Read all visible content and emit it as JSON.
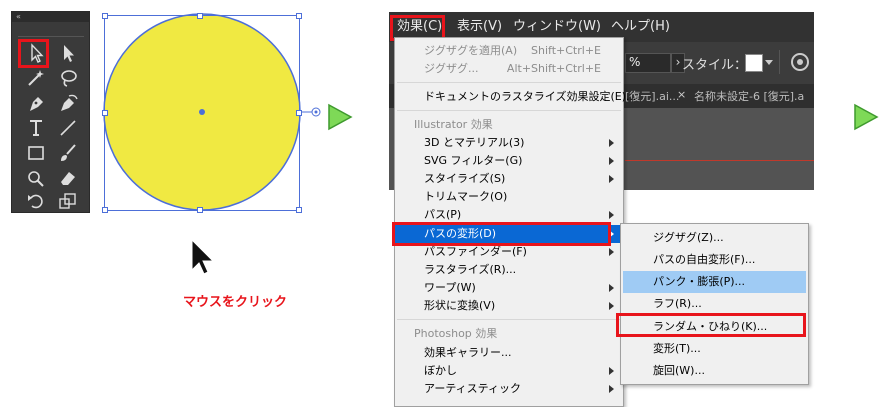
{
  "tools_panel": {
    "collapse_glyph": "«",
    "tool_names": [
      "selection-tool",
      "direct-selection-tool",
      "magic-wand-tool",
      "lasso-tool",
      "pen-tool",
      "curvature-tool",
      "type-tool",
      "line-segment-tool",
      "rectangle-tool",
      "paintbrush-tool",
      "shaper-tool",
      "eraser-tool",
      "rotate-tool",
      "free-transform-tool"
    ]
  },
  "canvas": {
    "shape": "circle",
    "fill_color": "#f0e942",
    "stroke_color": "#4d6fd8",
    "state": "selected"
  },
  "caption": {
    "text": "マウスをクリック"
  },
  "step_arrows": {
    "color": "#7ed957",
    "glyph": "▶"
  },
  "menubar": {
    "items": [
      "効果(C)",
      "表示(V)",
      "ウィンドウ(W)",
      "ヘルプ(H)"
    ],
    "active": "効果(C)"
  },
  "options_bar": {
    "percent_suffix": "%",
    "style_label": "スタイル：",
    "chevron": "›"
  },
  "doc_tabs": {
    "tab1_title": "[復元].ai...",
    "tab2_title": "名称未設定-6 [復元].a",
    "close_glyph": "×"
  },
  "effect_menu": {
    "items": [
      {
        "label": "ジグザグを適用(A)",
        "shortcut": "Shift+Ctrl+E",
        "disabled": true
      },
      {
        "label": "ジグザグ...",
        "shortcut": "Alt+Shift+Ctrl+E",
        "disabled": true
      },
      {
        "label": "ドキュメントのラスタライズ効果設定(E)..."
      },
      {
        "label": "Illustrator 効果",
        "header": true
      },
      {
        "label": "3D とマテリアル(3)",
        "submenu": true
      },
      {
        "label": "SVG フィルター(G)",
        "submenu": true
      },
      {
        "label": "スタイライズ(S)",
        "submenu": true
      },
      {
        "label": "トリムマーク(O)"
      },
      {
        "label": "パス(P)",
        "submenu": true
      },
      {
        "label": "パスの変形(D)",
        "submenu": true,
        "active": true
      },
      {
        "label": "パスファインダー(F)",
        "submenu": true
      },
      {
        "label": "ラスタライズ(R)..."
      },
      {
        "label": "ワープ(W)",
        "submenu": true
      },
      {
        "label": "形状に変換(V)",
        "submenu": true
      },
      {
        "label": "Photoshop 効果",
        "header": true
      },
      {
        "label": "効果ギャラリー..."
      },
      {
        "label": "ぼかし",
        "submenu": true
      },
      {
        "label": "アーティスティック",
        "submenu": true
      }
    ]
  },
  "distort_submenu": {
    "items": [
      {
        "label": "ジグザグ(Z)..."
      },
      {
        "label": "パスの自由変形(F)..."
      },
      {
        "label": "パンク・膨張(P)...",
        "hover": true
      },
      {
        "label": "ラフ(R)..."
      },
      {
        "label": "ランダム・ひねり(K)...",
        "highlighted": true
      },
      {
        "label": "変形(T)..."
      },
      {
        "label": "旋回(W)..."
      }
    ]
  },
  "colors": {
    "highlight_red": "#e8141b",
    "menu_active_blue": "#0a68d4",
    "submenu_hover_blue": "#9fcbf4",
    "panel_dark": "#3a3a3a",
    "selection_blue": "#4d6fd8"
  }
}
